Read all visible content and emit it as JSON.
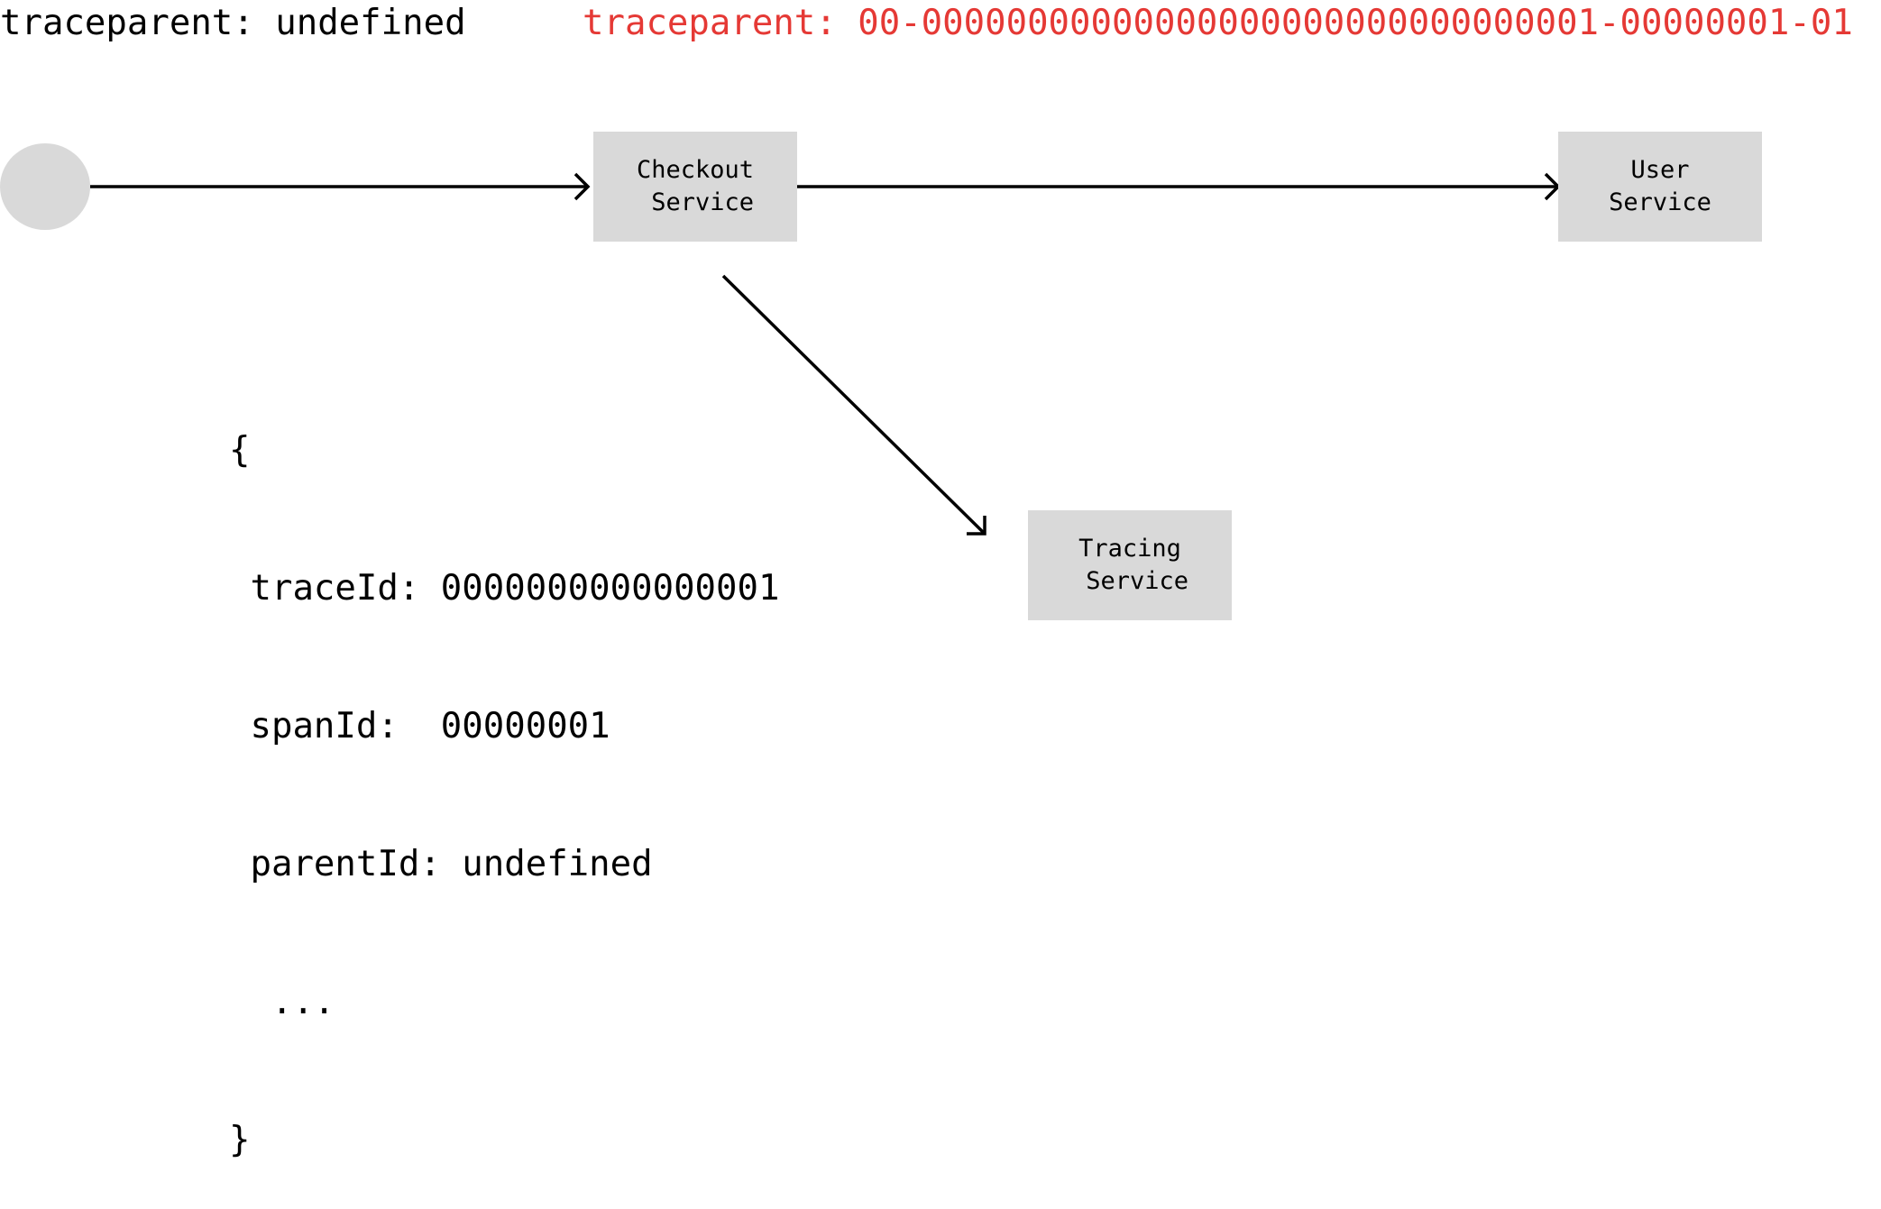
{
  "header": {
    "incoming": "traceparent: undefined",
    "outgoing": "traceparent: 00-00000000000000000000000000000001-00000001-01",
    "outgoing_color": "#e53935"
  },
  "nodes": {
    "client_icon": "client-circle",
    "checkout": "Checkout\n Service",
    "user": "User\nService",
    "tracing": "Tracing\n Service"
  },
  "span": {
    "open": "{",
    "trace_id": " traceId: 0000000000000001",
    "span_id": " spanId:  00000001",
    "parent_id": " parentId: undefined",
    "more": "  ...",
    "close": "}"
  }
}
